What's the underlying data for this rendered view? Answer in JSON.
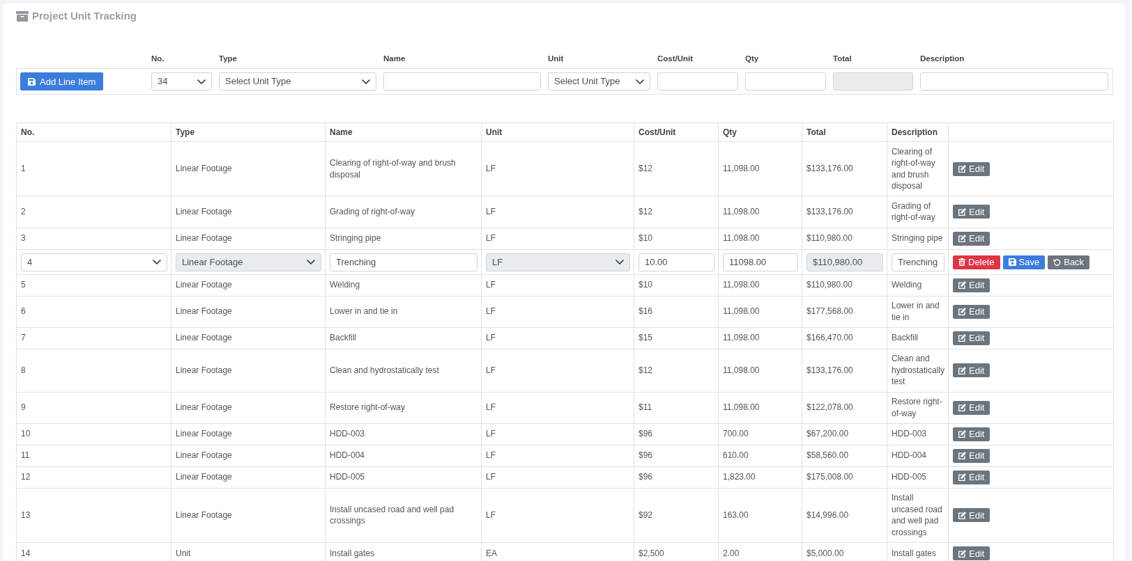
{
  "page": {
    "title": "Project Unit Tracking"
  },
  "new_item_form": {
    "add_button": {
      "label": "Add Line Item",
      "kind": "save"
    },
    "fields": [
      {
        "label": "No.",
        "kind": "select",
        "value": "34",
        "disabled": false
      },
      {
        "label": "Type",
        "kind": "select",
        "value": "Select Unit Type",
        "disabled": false
      },
      {
        "label": "Name",
        "kind": "input",
        "disabled": false
      },
      {
        "label": "Unit",
        "kind": "select",
        "value": "Select Unit Type",
        "disabled": false
      },
      {
        "label": "Cost/Unit",
        "kind": "input",
        "disabled": false
      },
      {
        "label": "Qty",
        "kind": "input",
        "disabled": false
      },
      {
        "label": "Total",
        "kind": "input",
        "disabled": true
      },
      {
        "label": "Description",
        "kind": "input",
        "disabled": false
      }
    ]
  },
  "table": {
    "columns": [
      "No.",
      "Type",
      "Name",
      "Unit",
      "Cost/Unit",
      "Qty",
      "Total",
      "Description"
    ],
    "rows": [
      {
        "kind": "view",
        "cells": [
          "1",
          "Linear Footage",
          "Clearing of right-of-way and brush disposal",
          "LF",
          "$12",
          "11,098.00",
          "$133,176.00",
          "Clearing of right-of-way and brush disposal"
        ],
        "actions": [
          {
            "kind": "edit",
            "label": "Edit"
          }
        ]
      },
      {
        "kind": "view",
        "cells": [
          "2",
          "Linear Footage",
          "Grading of right-of-way",
          "LF",
          "$12",
          "11,098.00",
          "$133,176.00",
          "Grading of right-of-way"
        ],
        "actions": [
          {
            "kind": "edit",
            "label": "Edit"
          }
        ]
      },
      {
        "kind": "view",
        "cells": [
          "3",
          "Linear Footage",
          "Stringing pipe",
          "LF",
          "$10",
          "11,098.00",
          "$110,980.00",
          "Stringing pipe"
        ],
        "actions": [
          {
            "kind": "edit",
            "label": "Edit"
          }
        ]
      },
      {
        "kind": "edit",
        "fields": [
          {
            "kind": "select",
            "value": "4",
            "disabled": false
          },
          {
            "kind": "select",
            "value": "Linear Footage",
            "disabled": true
          },
          {
            "kind": "input",
            "value": "Trenching",
            "disabled": false
          },
          {
            "kind": "select",
            "value": "LF",
            "disabled": true
          },
          {
            "kind": "input",
            "value": "10.00",
            "disabled": false
          },
          {
            "kind": "input",
            "value": "11098.00",
            "disabled": false
          },
          {
            "kind": "input",
            "value": "$110,980.00",
            "disabled": true
          },
          {
            "kind": "input",
            "value": "Trenching",
            "disabled": false
          }
        ],
        "actions": [
          {
            "kind": "delete",
            "label": "Delete"
          },
          {
            "kind": "save",
            "label": "Save"
          },
          {
            "kind": "back",
            "label": "Back"
          }
        ]
      },
      {
        "kind": "view",
        "cells": [
          "5",
          "Linear Footage",
          "Welding",
          "LF",
          "$10",
          "11,098.00",
          "$110,980.00",
          "Welding"
        ],
        "actions": [
          {
            "kind": "edit",
            "label": "Edit"
          }
        ]
      },
      {
        "kind": "view",
        "cells": [
          "6",
          "Linear Footage",
          "Lower in and tie in",
          "LF",
          "$16",
          "11,098.00",
          "$177,568.00",
          "Lower in and tie in"
        ],
        "actions": [
          {
            "kind": "edit",
            "label": "Edit"
          }
        ]
      },
      {
        "kind": "view",
        "cells": [
          "7",
          "Linear Footage",
          "Backfill",
          "LF",
          "$15",
          "11,098.00",
          "$166,470.00",
          "Backfill"
        ],
        "actions": [
          {
            "kind": "edit",
            "label": "Edit"
          }
        ]
      },
      {
        "kind": "view",
        "cells": [
          "8",
          "Linear Footage",
          "Clean and hydrostatically test",
          "LF",
          "$12",
          "11,098.00",
          "$133,176.00",
          "Clean and hydrostatically test"
        ],
        "actions": [
          {
            "kind": "edit",
            "label": "Edit"
          }
        ]
      },
      {
        "kind": "view",
        "cells": [
          "9",
          "Linear Footage",
          "Restore right-of-way",
          "LF",
          "$11",
          "11,098.00",
          "$122,078.00",
          "Restore right-of-way"
        ],
        "actions": [
          {
            "kind": "edit",
            "label": "Edit"
          }
        ]
      },
      {
        "kind": "view",
        "cells": [
          "10",
          "Linear Footage",
          "HDD-003",
          "LF",
          "$96",
          "700.00",
          "$67,200.00",
          "HDD-003"
        ],
        "actions": [
          {
            "kind": "edit",
            "label": "Edit"
          }
        ]
      },
      {
        "kind": "view",
        "cells": [
          "11",
          "Linear Footage",
          "HDD-004",
          "LF",
          "$96",
          "610.00",
          "$58,560.00",
          "HDD-004"
        ],
        "actions": [
          {
            "kind": "edit",
            "label": "Edit"
          }
        ]
      },
      {
        "kind": "view",
        "cells": [
          "12",
          "Linear Footage",
          "HDD-005",
          "LF",
          "$96",
          "1,823.00",
          "$175,008.00",
          "HDD-005"
        ],
        "actions": [
          {
            "kind": "edit",
            "label": "Edit"
          }
        ]
      },
      {
        "kind": "view",
        "cells": [
          "13",
          "Linear Footage",
          "Install uncased road and well pad crossings",
          "LF",
          "$92",
          "163.00",
          "$14,996.00",
          "Install uncased road and well pad crossings"
        ],
        "actions": [
          {
            "kind": "edit",
            "label": "Edit"
          }
        ]
      },
      {
        "kind": "view",
        "cells": [
          "14",
          "Unit",
          "Install gates",
          "EA",
          "$2,500",
          "2.00",
          "$5,000.00",
          "Install gates"
        ],
        "actions": [
          {
            "kind": "edit",
            "label": "Edit"
          }
        ]
      }
    ]
  }
}
